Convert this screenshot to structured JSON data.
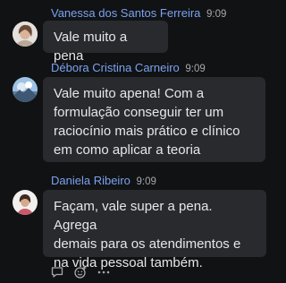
{
  "messages": [
    {
      "author": "Vanessa dos Santos Ferreira",
      "time": "9:09",
      "text": "Vale muito a pena",
      "avatar": "avatar-photo"
    },
    {
      "author": "Débora Cristina Carneiro",
      "time": "9:09",
      "text": "Vale muito apena! Com a\nformulação conseguir ter um\nraciocínio mais prático e clínico\nem como aplicar a teoria",
      "avatar": "avatar-photo"
    },
    {
      "author": "Daniela Ribeiro",
      "time": "9:09",
      "text": "Façam, vale super a pena. Agrega\ndemais para os atendimentos e\nna vida pessoal também.",
      "avatar": "avatar-photo"
    }
  ],
  "toolbar": {
    "icons": [
      "reply-icon",
      "emoji-reaction-icon",
      "more-options-icon"
    ]
  },
  "colors": {
    "background": "#111214",
    "bubble": "#292a2e",
    "author": "#7aa2f0",
    "text": "#e6e7e9",
    "time": "#a6a7ab"
  }
}
